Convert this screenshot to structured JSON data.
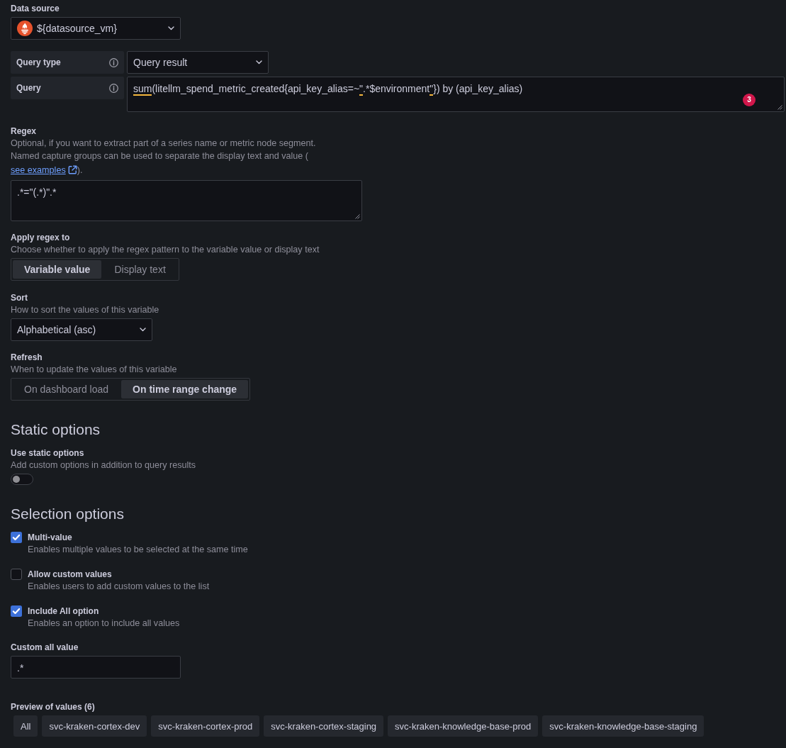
{
  "data_source": {
    "label": "Data source",
    "value": "${datasource_vm}"
  },
  "query_type": {
    "label": "Query type",
    "value": "Query result"
  },
  "query": {
    "label": "Query",
    "segments": [
      {
        "text": "sum",
        "flagged": true
      },
      {
        "text": "(litellm_spend_metric_created{api_key_alias=~",
        "flagged": false
      },
      {
        "text": "\"",
        "flagged": true
      },
      {
        "text": ".*$environment",
        "flagged": false
      },
      {
        "text": "\"",
        "flagged": true
      },
      {
        "text": "}) by (api_key_alias)",
        "flagged": false
      }
    ],
    "problem_count": "3"
  },
  "regex": {
    "label": "Regex",
    "description": "Optional, if you want to extract part of a series name or metric node segment.",
    "description_2": "Named capture groups can be used to separate the display text and value (",
    "link": "see examples",
    "description_end": ").",
    "value": ".*=\"(.*)\".*"
  },
  "apply_regex": {
    "label": "Apply regex to",
    "description": "Choose whether to apply the regex pattern to the variable value or display text",
    "options": [
      {
        "label": "Variable value",
        "selected": true
      },
      {
        "label": "Display text",
        "selected": false
      }
    ]
  },
  "sort": {
    "label": "Sort",
    "description": "How to sort the values of this variable",
    "value": "Alphabetical (asc)"
  },
  "refresh": {
    "label": "Refresh",
    "description": "When to update the values of this variable",
    "options": [
      {
        "label": "On dashboard load",
        "selected": false
      },
      {
        "label": "On time range change",
        "selected": true
      }
    ]
  },
  "static_options": {
    "heading": "Static options",
    "label": "Use static options",
    "description": "Add custom options in addition to query results",
    "on": false
  },
  "selection_options": {
    "heading": "Selection options",
    "items": [
      {
        "label": "Multi-value",
        "description": "Enables multiple values to be selected at the same time",
        "checked": true
      },
      {
        "label": "Allow custom values",
        "description": "Enables users to add custom values to the list",
        "checked": false
      },
      {
        "label": "Include All option",
        "description": "Enables an option to include all values",
        "checked": true
      }
    ]
  },
  "custom_all_value": {
    "label": "Custom all value",
    "value": ".*"
  },
  "preview": {
    "label": "Preview of values (6)",
    "values": [
      "All",
      "svc-kraken-cortex-dev",
      "svc-kraken-cortex-prod",
      "svc-kraken-cortex-staging",
      "svc-kraken-knowledge-base-prod",
      "svc-kraken-knowledge-base-staging"
    ]
  }
}
